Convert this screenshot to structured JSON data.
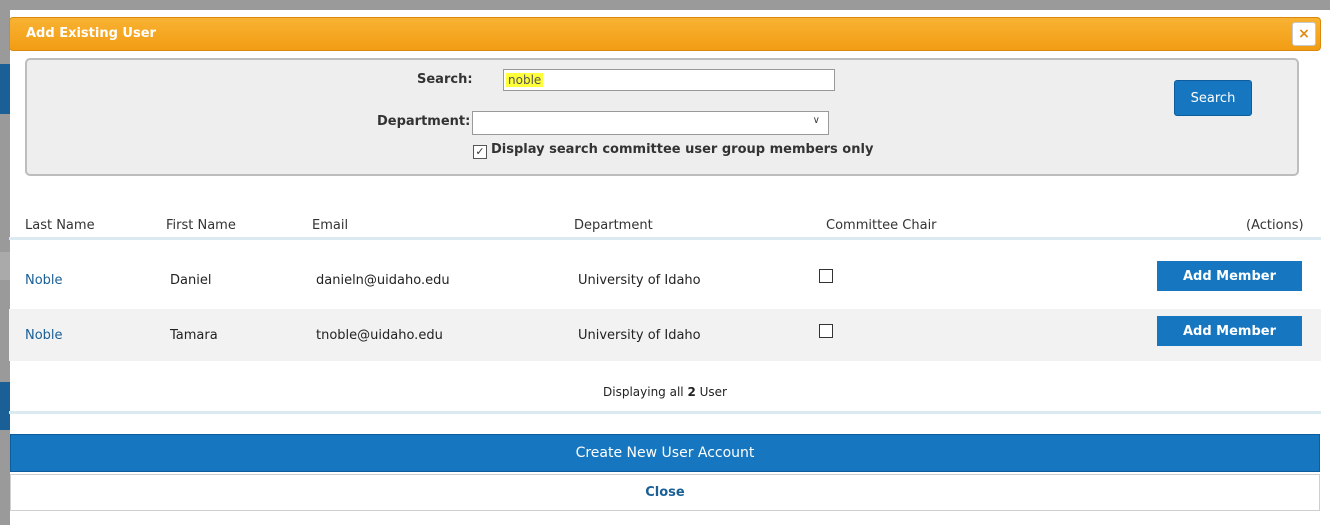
{
  "dialog": {
    "title": "Add Existing User",
    "close_icon": "×"
  },
  "search": {
    "search_label": "Search:",
    "search_value": "noble",
    "department_label": "Department:",
    "department_value": "",
    "committee_only_checked": true,
    "committee_only_label": "Display search committee user group members only",
    "search_button": "Search"
  },
  "table": {
    "headers": [
      "Last Name",
      "First Name",
      "Email",
      "Department",
      "Committee Chair",
      "(Actions)"
    ],
    "rows": [
      {
        "last_name": "Noble",
        "first_name": "Daniel",
        "email": "danieln@uidaho.edu",
        "department": "University of Idaho",
        "committee_chair": false,
        "action": "Add Member"
      },
      {
        "last_name": "Noble",
        "first_name": "Tamara",
        "email": "tnoble@uidaho.edu",
        "department": "University of Idaho",
        "committee_chair": false,
        "action": "Add Member"
      }
    ],
    "summary_prefix": "Displaying all",
    "summary_count": "2",
    "summary_suffix": "User"
  },
  "footer": {
    "create_button": "Create New User Account",
    "close_button": "Close"
  },
  "colors": {
    "accent_orange": "#f29d14",
    "primary_blue": "#1677c0",
    "link_blue": "#1a5f96"
  }
}
